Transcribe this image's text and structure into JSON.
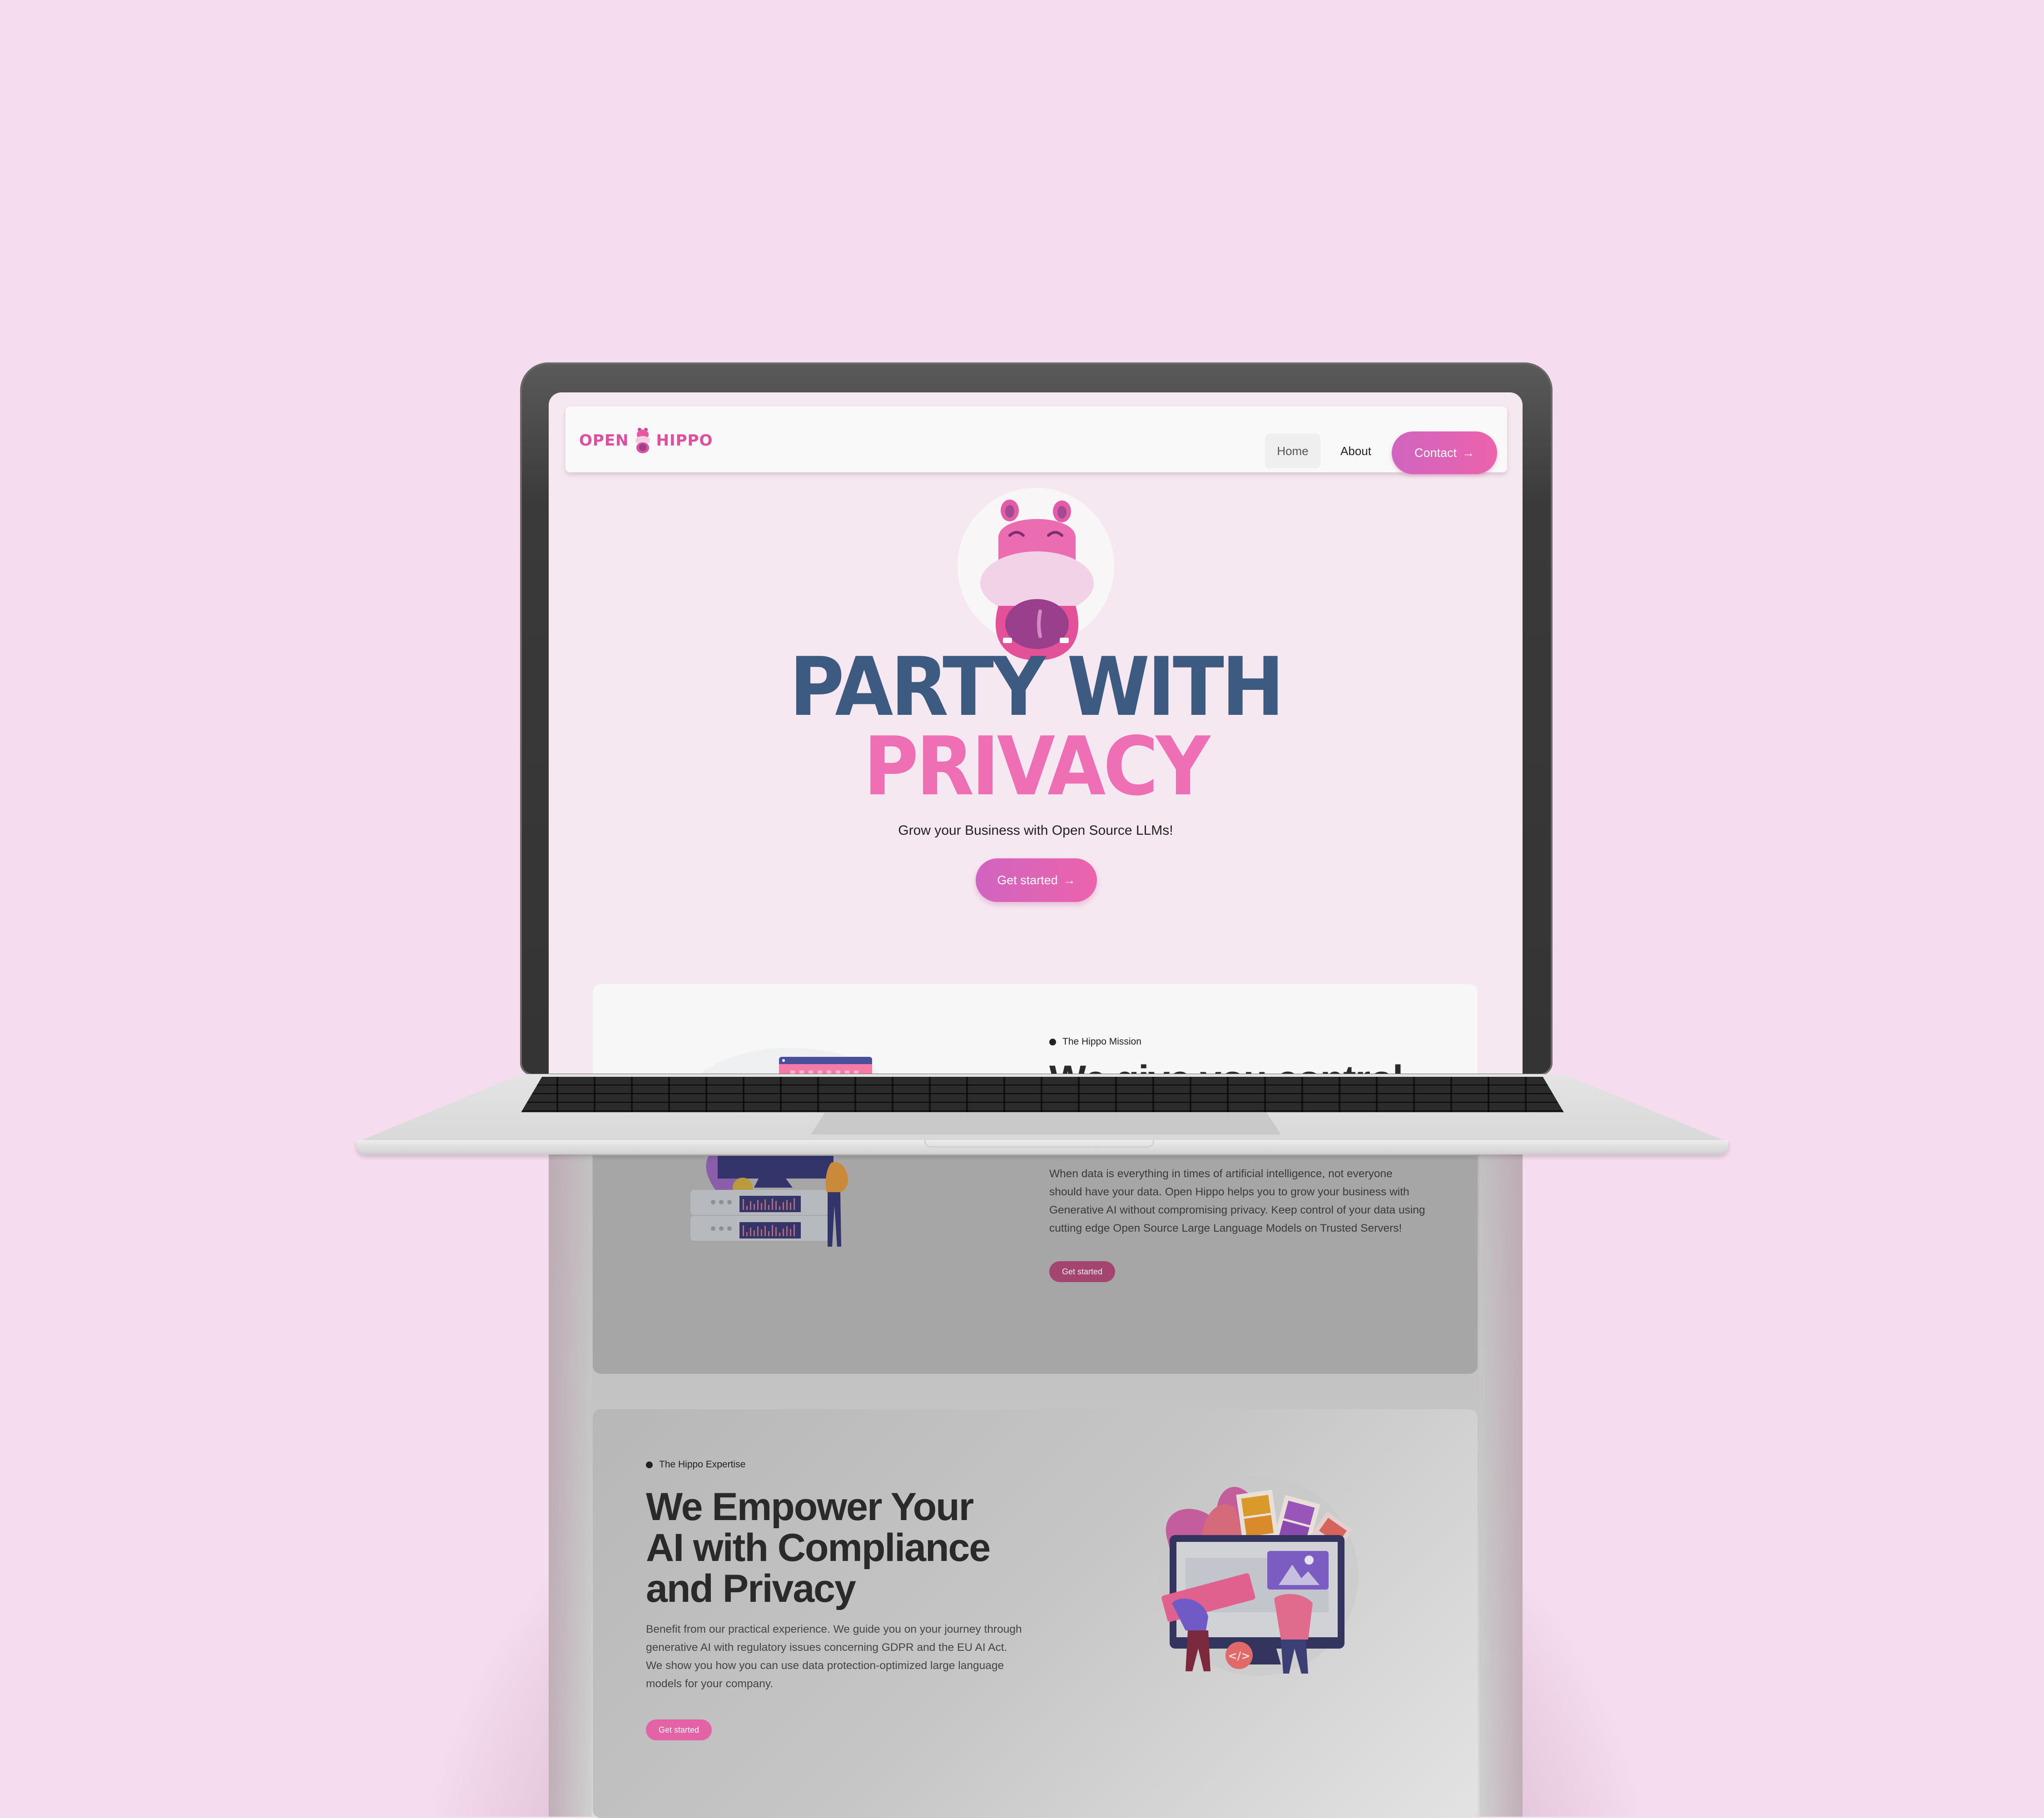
{
  "brand": {
    "logo_left": "OPEN",
    "logo_right": "HIPPO",
    "colors": {
      "pink": "#ec63ac",
      "purple_pink": "#d064c0",
      "navy": "#3d5a80",
      "background": "#f5dcee"
    }
  },
  "nav": {
    "items": [
      {
        "label": "Home",
        "active": true
      },
      {
        "label": "About",
        "active": false
      }
    ],
    "cta_label": "Contact",
    "cta_icon": "arrow-right-icon"
  },
  "hero": {
    "title_line1": "PARTY WITH",
    "title_line2": "PRIVACY",
    "subtitle": "Grow your Business with Open Source LLMs!",
    "button_label": "Get started",
    "button_icon": "arrow-right-icon",
    "mascot": "hippo-mascot"
  },
  "mission": {
    "eyebrow": "The Hippo Mission",
    "heading": "We give you control",
    "body": "When data is everything in times of artificial intelligence, not everyone should have your data. Open Hippo helps you to grow your business with Generative AI without compromising privacy. Keep control of your data using cutting edge Open Source Large Language Models on Trusted Servers!",
    "button_label": "Get started",
    "illustration": "server-monitor-illustration"
  },
  "expertise": {
    "eyebrow": "The Hippo Expertise",
    "heading_lines": [
      "We Empower Your",
      "AI with Compliance",
      "and Privacy"
    ],
    "body": "Benefit from our practical experience. We guide you on your journey through generative AI with regulatory issues concerning GDPR and the EU AI Act. We show you how you can use data protection-optimized large language models for your company.",
    "button_label": "Get started",
    "illustration": "web-design-team-illustration",
    "code_glyph": "</>"
  }
}
